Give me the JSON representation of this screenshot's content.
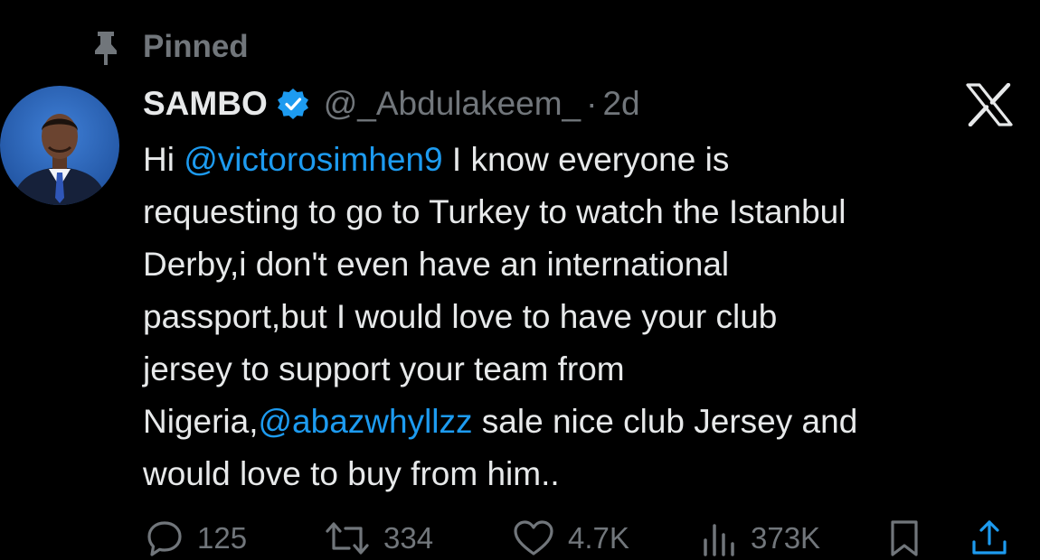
{
  "pinned": {
    "label": "Pinned"
  },
  "author": {
    "display_name": "SAMBO",
    "handle": "@_Abdulakeem_",
    "separator": "·",
    "time": "2d"
  },
  "tweet": {
    "lines": [
      [
        {
          "text": "Hi "
        },
        {
          "text": "@victorosimhen9",
          "mention": true
        },
        {
          "text": " I know everyone is"
        }
      ],
      [
        {
          "text": "requesting to go to Turkey to watch the Istanbul"
        }
      ],
      [
        {
          "text": "Derby,i don't even have an international"
        }
      ],
      [
        {
          "text": "passport,but I would love to have your club"
        }
      ],
      [
        {
          "text": "jersey to support your team from"
        }
      ],
      [
        {
          "text": "Nigeria,"
        },
        {
          "text": "@abazwhyllzz",
          "mention": true
        },
        {
          "text": " sale nice club Jersey and"
        }
      ],
      [
        {
          "text": "would love to buy from him.."
        }
      ]
    ]
  },
  "actions": {
    "reply": {
      "icon": "reply-icon",
      "count": "125"
    },
    "repost": {
      "icon": "repost-icon",
      "count": "334"
    },
    "like": {
      "icon": "heart-icon",
      "count": "4.7K"
    },
    "views": {
      "icon": "views-icon",
      "count": "373K"
    },
    "bookmark": {
      "icon": "bookmark-icon"
    },
    "share": {
      "icon": "share-icon"
    }
  },
  "colors": {
    "background": "#000000",
    "text": "#e7e9ea",
    "muted": "#71767b",
    "accent": "#1d9bf0"
  }
}
